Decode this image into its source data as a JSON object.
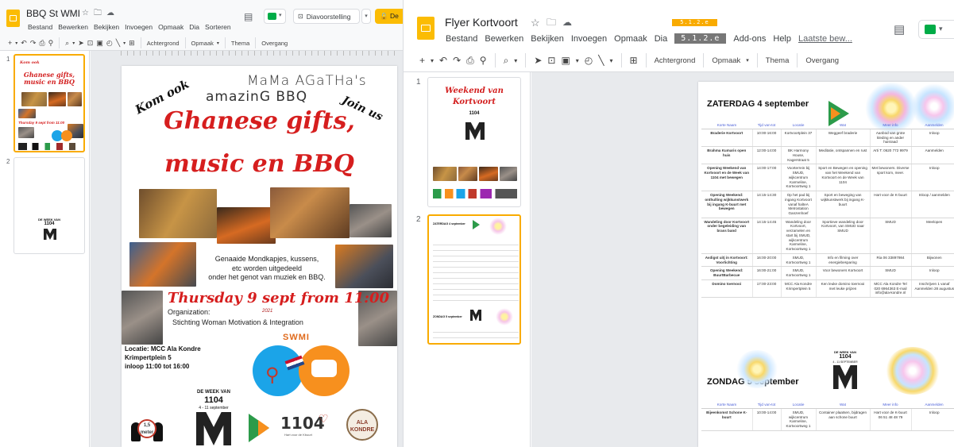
{
  "left_window": {
    "title": "BBQ St WMI",
    "menu": [
      "Bestand",
      "Bewerken",
      "Bekijken",
      "Invoegen",
      "Opmaak",
      "Dia",
      "Sorteren"
    ],
    "present_button": "Diavoorstelling",
    "share_partial": "De",
    "toolbar": {
      "background": "Achtergrond",
      "layout": "Opmaak",
      "theme": "Thema",
      "transition": "Overgang"
    },
    "slide_numbers": [
      "1",
      "2"
    ],
    "thumb2_lines": [
      "DE WEEK VAN",
      "1104"
    ],
    "slide": {
      "header_line1": "MaMa AGaTHa's",
      "header_line2": "amazinG BBQ",
      "kom_ook": "Kom ook",
      "join_us": "Join us",
      "title_line1": "Ghanese gifts,",
      "title_line2": "music en BBQ",
      "info_line1": "Genaaide Mondkapjes, kussens,",
      "info_line2": "etc worden uitgedeeld",
      "info_line3": "onder het genot van muziek en BBQ.",
      "date_line": "Thursday 9 sept  from 11:00",
      "organization_label": "Organization:",
      "year": "2021",
      "org_name": "Stichting Woman Motivation & Integration",
      "swmi": "SWMI",
      "location_line1": "Locatie: MCC Ala Kondre",
      "location_line2": "Krimpertplein 5",
      "location_line3": "inloop 11:00 tot 16:00",
      "distance_sign": "1,5 meter",
      "week_line1": "DE WEEK VAN",
      "week_line2": "1104",
      "week_line3": "4 - 11 september",
      "logo_1104": "1104",
      "hart": "Hart voor de Kbuurt",
      "ala": "ALA KONDRE"
    }
  },
  "right_window": {
    "title": "Flyer Kortvoort",
    "badge": "5.1.2.e",
    "menu": [
      "Bestand",
      "Bewerken",
      "Bekijken",
      "Invoegen",
      "Opmaak",
      "Dia"
    ],
    "menu_highlight": "5.1.2.e",
    "menu_after": [
      "Add-ons",
      "Help"
    ],
    "last_edit": "Laatste bew...",
    "toolbar": {
      "background": "Achtergrond",
      "layout": "Opmaak",
      "theme": "Thema",
      "transition": "Overgang"
    },
    "slide_numbers": [
      "1",
      "2"
    ],
    "thumb1": {
      "title_line1": "Weekend van",
      "title_line2": "Kortvoort",
      "week": "1104"
    },
    "thumb2": {
      "heading1": "ZATERDAG 4 september",
      "heading2": "ZONDAG 5 september"
    },
    "slide": {
      "day1": "ZATERDAG 4 september",
      "day2": "ZONDAG 5 september",
      "week_line1": "DE WEEK VAN",
      "week_line2": "1104",
      "week_line3": "4 - 11 SEPTEMBER",
      "columns": [
        "Korte Naam",
        "Tijd van-tot",
        "Locatie",
        "Wat",
        "Meer info",
        "Aanmelden"
      ],
      "rows": [
        [
          "Braderie Kortvoort",
          "10:00-16:00",
          "Kortvoortplein 37",
          "Weggeef braderie",
          "Aanbod van grote kleding en ander huisraad",
          "Inloop"
        ],
        [
          "Brahma Kumaris open huis",
          "12:00-14:00",
          "BK Harmony House, Kagerstraat 5",
          "Meditatie, ontspannen en rust",
          "Arti T: 0620 772 9979",
          "Aanmelden"
        ],
        [
          "Opening Weekend van Kortvoort en de Week van 1104 met bewegen",
          "14:00-17:00",
          "Voorterrein bij SMUD, wijkcentrum Karmeline, Kortvoortweg 1",
          "Sport en Bewegen en opening van het Weekend van Kortvoort en de Week van 1104",
          "Met bewoners. Diverse sport kom, meer.",
          "Inloop"
        ],
        [
          "Opening Weekend: onthulling wijkkunstwerk bij ingang K-buurt met bewegen",
          "14:15-14:30",
          "Op het pad bij ingang Kortvoort vanaf halteA Metrostation Ganzenhoef",
          "Sport en beweging van wijkkunstwerk bij ingang K-buurt",
          "Hart voor de K-buurt",
          "Inloop / aanmelden"
        ],
        [
          "Wandeling door Kortvoort onder begeleiding van brass band",
          "14:15-14:45",
          "Wandeling door Kortvoort, verzamelen en start bij SMUD, wijkcentrum Karmeline, Kortvoortweg 1",
          "Sportieve wandeling door Kortvoort, van SMUD naar SMUD",
          "SMUD",
          "Meelopen"
        ],
        [
          "Avdigst uitj in Kortvoort: Voorlichting",
          "16:00-20:00",
          "SMUD, Kortvoortweg 1",
          "Info en filming over energiebesparing",
          "Ria 06 33897984",
          "Bijwonen"
        ],
        [
          "Opening Weekend: BuurtBarbecue",
          "16:00-21:00",
          "SMUD, Kortvoortweg 1",
          "Voor bewoners Kortvoort",
          "SMUD",
          "Inloop"
        ],
        [
          "Domino toernooi",
          "17:00-23:00",
          "MCC Ala Kondre Krimpertplein 5",
          "Ken leuke domino toernooi met leuke prijzen",
          "MCC Ala Kondre Tel 020 6964363 E-mail info@ala-kondre.nl",
          "Inschrijven 1 vanaf Aanmelden 28 augustus"
        ]
      ],
      "rows2": [
        [
          "Bijeenkomst Schone K-buurt",
          "10:00-14:00",
          "SMUD, wijkcentrum Karmeline, Kortvoortweg 1",
          "Container plaatsen, bijdragen aan schone buurt",
          "Hart voor de K-buurt 06 51 48 48 79",
          "Inloop"
        ]
      ]
    }
  }
}
